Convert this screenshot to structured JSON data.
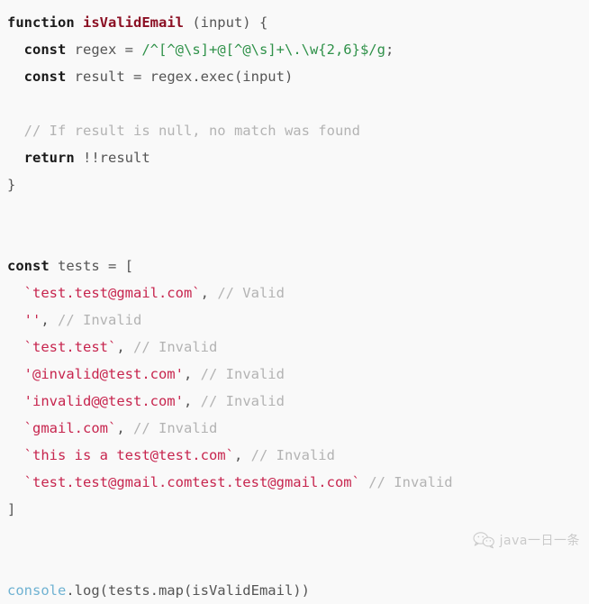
{
  "editor": {
    "language": "javascript",
    "background_color": "#f9f9f9",
    "colors": {
      "keyword": "#1a1a1a",
      "function_name": "#8b0f23",
      "plain": "#555555",
      "regex": "#2f9149",
      "string": "#c7254e",
      "comment": "#b3b3b3",
      "builtin": "#6fb2d2"
    },
    "lines": [
      {
        "index": 1,
        "tokens": [
          {
            "type": "keyword",
            "text": "function"
          },
          {
            "type": "plain",
            "text": " "
          },
          {
            "type": "function_name",
            "text": "isValidEmail"
          },
          {
            "type": "plain",
            "text": " (input) {"
          }
        ]
      },
      {
        "index": 2,
        "tokens": [
          {
            "type": "plain",
            "text": "  "
          },
          {
            "type": "keyword",
            "text": "const"
          },
          {
            "type": "plain",
            "text": " regex = "
          },
          {
            "type": "regex",
            "text": "/^[^@\\s]+@[^@\\s]+\\.\\w{2,6}$/g"
          },
          {
            "type": "plain",
            "text": ";"
          }
        ]
      },
      {
        "index": 3,
        "tokens": [
          {
            "type": "plain",
            "text": "  "
          },
          {
            "type": "keyword",
            "text": "const"
          },
          {
            "type": "plain",
            "text": " result = regex.exec(input)"
          }
        ]
      },
      {
        "index": 4,
        "tokens": []
      },
      {
        "index": 5,
        "tokens": [
          {
            "type": "plain",
            "text": "  "
          },
          {
            "type": "comment",
            "text": "// If result is null, no match was found"
          }
        ]
      },
      {
        "index": 6,
        "tokens": [
          {
            "type": "plain",
            "text": "  "
          },
          {
            "type": "keyword",
            "text": "return"
          },
          {
            "type": "plain",
            "text": " !!result"
          }
        ]
      },
      {
        "index": 7,
        "tokens": [
          {
            "type": "plain",
            "text": "}"
          }
        ]
      },
      {
        "index": 8,
        "tokens": []
      },
      {
        "index": 9,
        "tokens": []
      },
      {
        "index": 10,
        "tokens": [
          {
            "type": "keyword",
            "text": "const"
          },
          {
            "type": "plain",
            "text": " tests = ["
          }
        ]
      },
      {
        "index": 11,
        "tokens": [
          {
            "type": "plain",
            "text": "  "
          },
          {
            "type": "string",
            "text": "`test.test@gmail.com`"
          },
          {
            "type": "plain",
            "text": ", "
          },
          {
            "type": "comment",
            "text": "// Valid"
          }
        ]
      },
      {
        "index": 12,
        "tokens": [
          {
            "type": "plain",
            "text": "  "
          },
          {
            "type": "string",
            "text": "''"
          },
          {
            "type": "plain",
            "text": ", "
          },
          {
            "type": "comment",
            "text": "// Invalid"
          }
        ]
      },
      {
        "index": 13,
        "tokens": [
          {
            "type": "plain",
            "text": "  "
          },
          {
            "type": "string",
            "text": "`test.test`"
          },
          {
            "type": "plain",
            "text": ", "
          },
          {
            "type": "comment",
            "text": "// Invalid"
          }
        ]
      },
      {
        "index": 14,
        "tokens": [
          {
            "type": "plain",
            "text": "  "
          },
          {
            "type": "string",
            "text": "'@invalid@test.com'"
          },
          {
            "type": "plain",
            "text": ", "
          },
          {
            "type": "comment",
            "text": "// Invalid"
          }
        ]
      },
      {
        "index": 15,
        "tokens": [
          {
            "type": "plain",
            "text": "  "
          },
          {
            "type": "string",
            "text": "'invalid@@test.com'"
          },
          {
            "type": "plain",
            "text": ", "
          },
          {
            "type": "comment",
            "text": "// Invalid"
          }
        ]
      },
      {
        "index": 16,
        "tokens": [
          {
            "type": "plain",
            "text": "  "
          },
          {
            "type": "string",
            "text": "`gmail.com`"
          },
          {
            "type": "plain",
            "text": ", "
          },
          {
            "type": "comment",
            "text": "// Invalid"
          }
        ]
      },
      {
        "index": 17,
        "tokens": [
          {
            "type": "plain",
            "text": "  "
          },
          {
            "type": "string",
            "text": "`this is a test@test.com`"
          },
          {
            "type": "plain",
            "text": ", "
          },
          {
            "type": "comment",
            "text": "// Invalid"
          }
        ]
      },
      {
        "index": 18,
        "tokens": [
          {
            "type": "plain",
            "text": "  "
          },
          {
            "type": "string",
            "text": "`test.test@gmail.comtest.test@gmail.com`"
          },
          {
            "type": "plain",
            "text": " "
          },
          {
            "type": "comment",
            "text": "// Invalid"
          }
        ]
      },
      {
        "index": 19,
        "tokens": [
          {
            "type": "plain",
            "text": "]"
          }
        ]
      },
      {
        "index": 20,
        "tokens": []
      },
      {
        "index": 21,
        "tokens": []
      },
      {
        "index": 22,
        "tokens": [
          {
            "type": "builtin",
            "text": "console"
          },
          {
            "type": "plain",
            "text": ".log(tests.map(isValidEmail))"
          }
        ]
      }
    ]
  },
  "watermark": {
    "text": "java一日一条",
    "icon": "wechat-logo-icon"
  }
}
